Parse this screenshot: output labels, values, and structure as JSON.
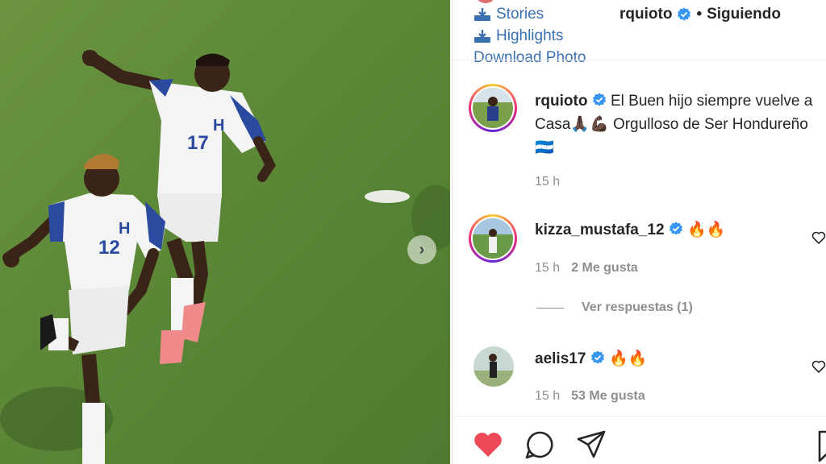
{
  "extension": {
    "stories_label": "Stories",
    "highlights_label": "Highlights",
    "download_label": "Download Photo"
  },
  "post_header": {
    "username": "rquioto",
    "separator": "•",
    "follow_label": "Siguiendo"
  },
  "caption": {
    "username": "rquioto",
    "text": "El Buen hijo siempre vuelve a Casa🙏🏿💪🏿 Orgulloso de Ser Hondureño 🇭🇳",
    "time": "15 h"
  },
  "comments": [
    {
      "username": "kizza_mustafa_12",
      "text": "🔥🔥",
      "time": "15 h",
      "likes": "2 Me gusta"
    },
    {
      "username": "aelis17",
      "text": "🔥🔥",
      "time": "15 h",
      "likes": "53 Me gusta"
    }
  ],
  "replies_label": "Ver respuestas (1)",
  "next_arrow": "›",
  "colors": {
    "link": "#3a6fb0",
    "verified": "#3897f0",
    "like_red": "#ed4956",
    "grass": "#5f8a3a"
  },
  "icons": [
    "stories-icon",
    "highlights-icon",
    "verified-icon",
    "heart-icon",
    "comment-icon",
    "share-icon",
    "save-icon",
    "next-arrow-icon"
  ]
}
